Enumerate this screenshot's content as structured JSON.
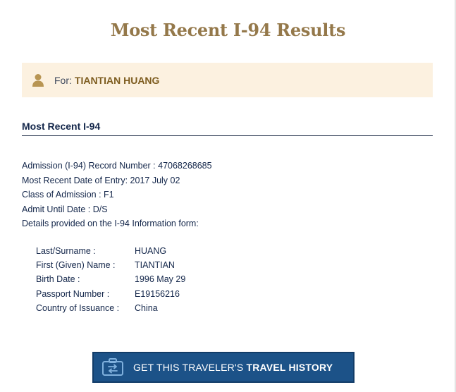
{
  "page": {
    "title": "Most Recent I-94 Results"
  },
  "traveler": {
    "for_label": "For:",
    "name": "TIANTIAN HUANG"
  },
  "section": {
    "title": "Most Recent I-94"
  },
  "record": {
    "lines": [
      "Admission (I-94) Record Number : 47068268685",
      "Most Recent Date of Entry: 2017 July 02",
      "Class of Admission : F1",
      "Admit Until Date : D/S",
      "Details provided on the I-94 Information form:"
    ]
  },
  "details": [
    {
      "label": "Last/Surname :",
      "value": "HUANG"
    },
    {
      "label": "First (Given) Name :",
      "value": "TIANTIAN"
    },
    {
      "label": "Birth Date :",
      "value": "1996 May 29"
    },
    {
      "label": "Passport Number :",
      "value": "E19156216"
    },
    {
      "label": "Country of Issuance :",
      "value": "China"
    }
  ],
  "cta": {
    "label_normal": "GET THIS TRAVELER'S ",
    "label_bold": "TRAVEL HISTORY",
    "icon": "suitcase-icon"
  },
  "colors": {
    "title": "#94784a",
    "for_box_bg": "#fcf1e0",
    "name": "#7d5c1f",
    "text": "#13264a",
    "button_bg": "#1c5288"
  }
}
